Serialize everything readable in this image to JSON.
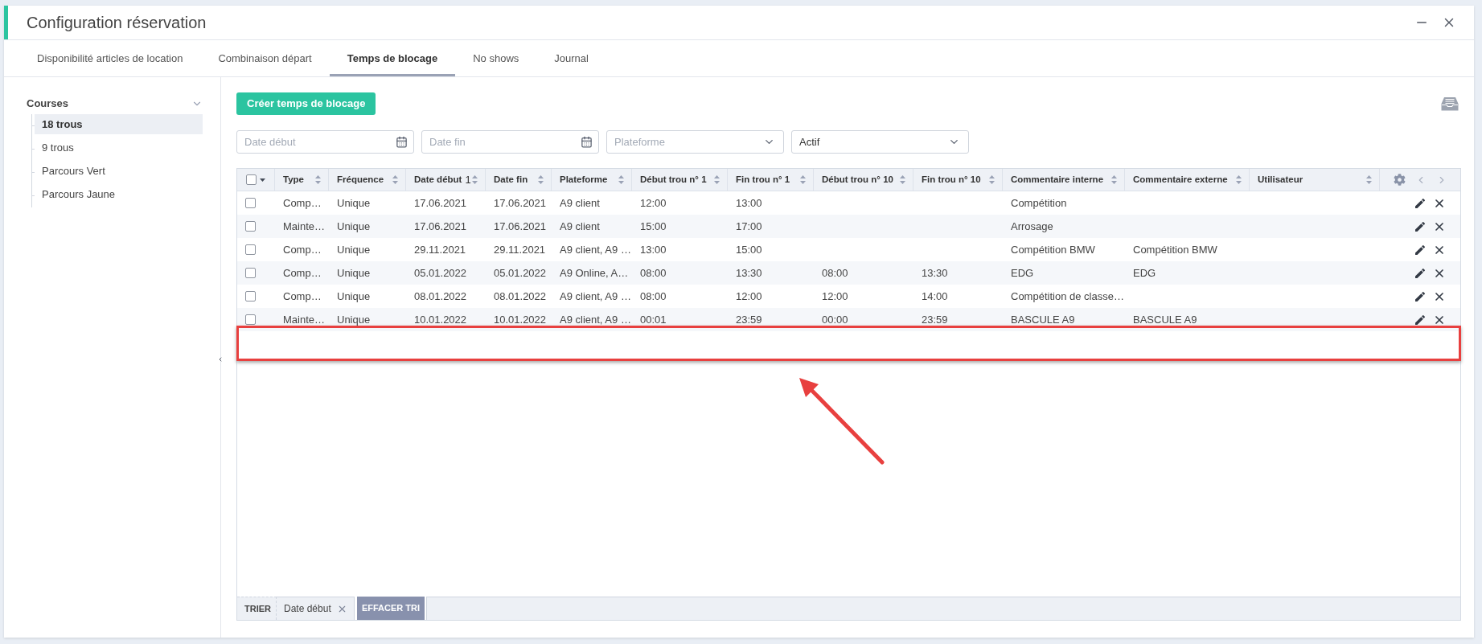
{
  "window": {
    "title": "Configuration réservation"
  },
  "tabs": [
    {
      "label": "Disponibilité articles de location",
      "selected": false
    },
    {
      "label": "Combinaison départ",
      "selected": false
    },
    {
      "label": "Temps de blocage",
      "selected": true
    },
    {
      "label": "No shows",
      "selected": false
    },
    {
      "label": "Journal",
      "selected": false
    }
  ],
  "sidebar": {
    "group": {
      "label": "Courses",
      "expanded": true
    },
    "items": [
      {
        "label": "18 trous",
        "selected": true
      },
      {
        "label": "9 trous",
        "selected": false
      },
      {
        "label": "Parcours Vert",
        "selected": false
      },
      {
        "label": "Parcours Jaune",
        "selected": false
      }
    ]
  },
  "toolbar": {
    "create_button": "Créer temps de blocage"
  },
  "filters": [
    {
      "kind": "date",
      "placeholder": "Date début"
    },
    {
      "kind": "date",
      "placeholder": "Date fin"
    },
    {
      "kind": "select",
      "placeholder": "Plateforme"
    },
    {
      "kind": "select",
      "value": "Actif"
    }
  ],
  "table": {
    "select_all": {
      "checked": false
    },
    "columns": [
      {
        "label": "Type"
      },
      {
        "label": "Fréquence"
      },
      {
        "label": "Date début",
        "sort_order": "1"
      },
      {
        "label": "Date fin"
      },
      {
        "label": "Plateforme"
      },
      {
        "label": "Début trou n° 1"
      },
      {
        "label": "Fin trou n° 1"
      },
      {
        "label": "Début trou n° 10"
      },
      {
        "label": "Fin trou n° 10"
      },
      {
        "label": "Commentaire interne"
      },
      {
        "label": "Commentaire externe"
      },
      {
        "label": "Utilisateur"
      }
    ],
    "rows": [
      {
        "checked": false,
        "cells": [
          "Comp…",
          "Unique",
          "17.06.2021",
          "17.06.2021",
          "A9 client",
          "12:00",
          "13:00",
          null,
          null,
          "Compétition",
          null,
          null
        ]
      },
      {
        "checked": false,
        "cells": [
          "Mainte…",
          "Unique",
          "17.06.2021",
          "17.06.2021",
          "A9 client",
          "15:00",
          "17:00",
          null,
          null,
          "Arrosage",
          null,
          null
        ]
      },
      {
        "checked": false,
        "cells": [
          "Comp…",
          "Unique",
          "29.11.2021",
          "29.11.2021",
          "A9 client, A9 …",
          "13:00",
          "15:00",
          null,
          null,
          "Compétition BMW",
          "Compétition BMW",
          null
        ]
      },
      {
        "checked": false,
        "cells": [
          "Comp…",
          "Unique",
          "05.01.2022",
          "05.01.2022",
          "A9 Online, A…",
          "08:00",
          "13:30",
          "08:00",
          "13:30",
          "EDG",
          "EDG",
          null
        ]
      },
      {
        "checked": false,
        "cells": [
          "Comp…",
          "Unique",
          "08.01.2022",
          "08.01.2022",
          "A9 client, A9 …",
          "08:00",
          "12:00",
          "12:00",
          "14:00",
          "Compétition de classe…",
          null,
          null
        ]
      },
      {
        "checked": false,
        "cells": [
          "Mainte…",
          "Unique",
          "10.01.2022",
          "10.01.2022",
          "A9 client, A9 …",
          "00:01",
          "23:59",
          "00:00",
          "23:59",
          "BASCULE A9",
          "BASCULE A9",
          null
        ]
      }
    ]
  },
  "sort_bar": {
    "label": "TRIER",
    "chips": [
      {
        "label": "Date début"
      }
    ],
    "clear_button": "EFFACER TRI"
  }
}
